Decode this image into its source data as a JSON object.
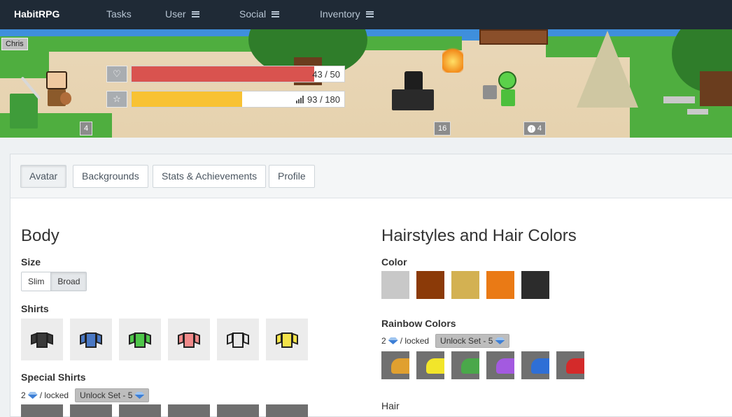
{
  "nav": {
    "brand": "HabitRPG",
    "items": [
      {
        "label": "Tasks"
      },
      {
        "label": "User"
      },
      {
        "label": "Social"
      },
      {
        "label": "Inventory"
      }
    ]
  },
  "header": {
    "player_name": "Chris",
    "health": {
      "value": 43,
      "max": 50,
      "text": "43 / 50",
      "fraction": 0.86,
      "color": "#d9534f"
    },
    "experience": {
      "value": 93,
      "max": 180,
      "text": "93 / 180",
      "fraction": 0.52,
      "color": "#f8c233"
    },
    "party_levels": [
      {
        "label": "4"
      },
      {
        "label": "16"
      },
      {
        "label": "4",
        "icon": "arrow-up-circle-icon"
      }
    ]
  },
  "tabs": [
    {
      "label": "Avatar",
      "active": true
    },
    {
      "label": "Backgrounds"
    },
    {
      "label": "Stats & Achievements"
    },
    {
      "label": "Profile"
    }
  ],
  "body_section": {
    "title": "Body",
    "size_label": "Size",
    "size_options": [
      "Slim",
      "Broad"
    ],
    "size_selected": "Broad",
    "shirts_label": "Shirts",
    "shirt_colors": [
      "#3a3a3a",
      "#4a78c4",
      "#4fc64a",
      "#f08a8a",
      "#e8e8e8",
      "#f4e34a"
    ],
    "special_shirts_label": "Special Shirts",
    "special_lock": {
      "cost": "2",
      "locked_text": "/ locked",
      "unlock_label": "Unlock Set - 5"
    }
  },
  "hair_section": {
    "title": "Hairstyles and Hair Colors",
    "color_label": "Color",
    "colors": [
      "#c8c8c8",
      "#8b3a08",
      "#d3b152",
      "#ea7a15",
      "#2c2c2c"
    ],
    "rainbow_label": "Rainbow Colors",
    "rainbow_lock": {
      "cost": "2",
      "locked_text": "/ locked",
      "unlock_label": "Unlock Set - 5"
    },
    "rainbow_colors": [
      "#e0a030",
      "#f2e52a",
      "#4aa84a",
      "#a35ae0",
      "#2f6fd6",
      "#d42a2a"
    ],
    "hair_label": "Hair"
  }
}
